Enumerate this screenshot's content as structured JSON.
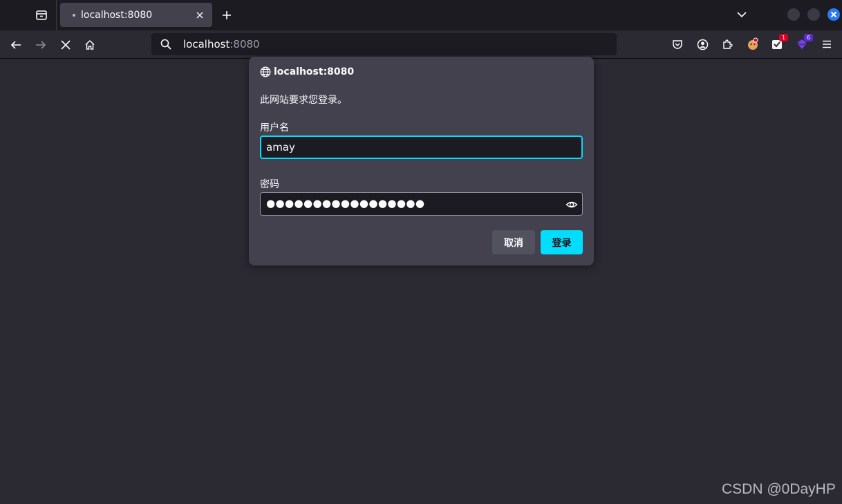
{
  "browser": {
    "tab": {
      "title": "localhost:8080"
    },
    "url": {
      "host": "localhost",
      "port": ":8080"
    },
    "toolbar_icons": [
      "pocket-icon",
      "account-icon",
      "extensions-icon",
      "extension-a-icon",
      "extension-b-icon",
      "extension-c-icon",
      "menu-icon"
    ],
    "badges": {
      "ext_b": "1",
      "ext_c": "6"
    }
  },
  "dialog": {
    "origin": "localhost:8080",
    "message": "此网站要求您登录。",
    "username_label": "用户名",
    "username_value": "amay",
    "password_label": "密码",
    "password_mask": "●●●●●●●●●●●●●●●●●",
    "cancel_label": "取消",
    "login_label": "登录"
  },
  "watermark": "CSDN @0DayHP",
  "colors": {
    "accent": "#00ddff",
    "dialog_bg": "#42414d",
    "page_bg": "#2b2a33"
  }
}
